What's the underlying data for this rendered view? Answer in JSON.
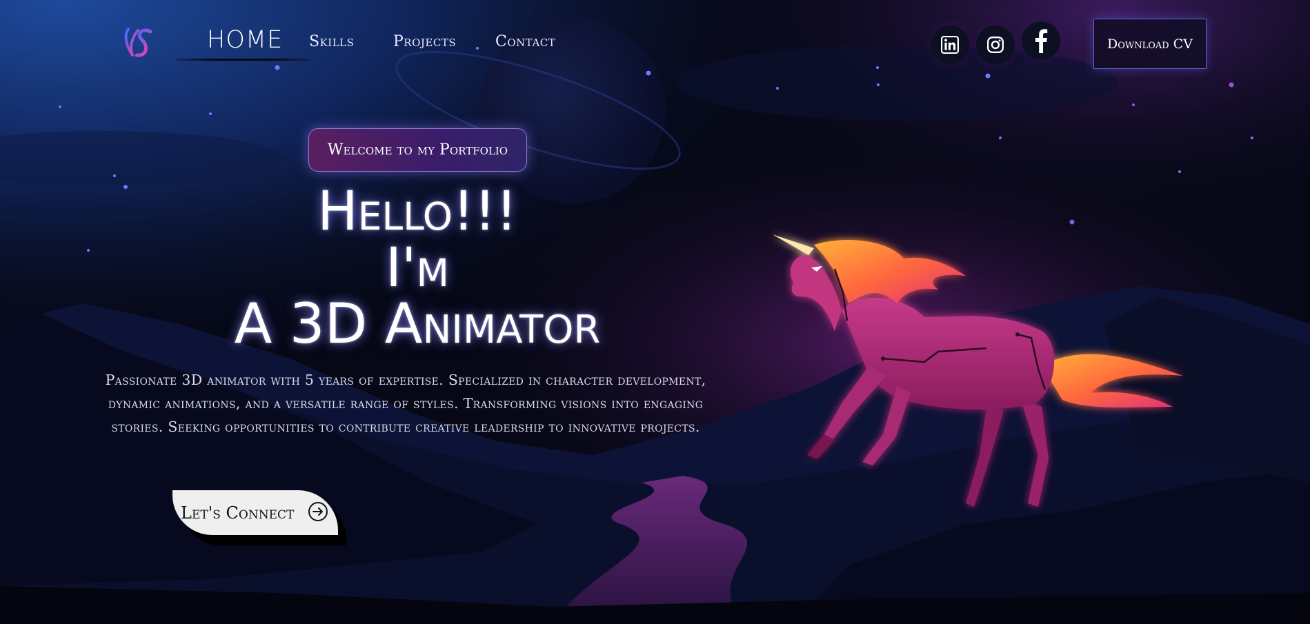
{
  "nav": {
    "home": "HOME",
    "skills": "Skills",
    "projects": "Projects",
    "contact": "Contact"
  },
  "social": {
    "linkedin_icon": "linkedin-icon",
    "instagram_icon": "instagram-icon",
    "facebook_icon": "facebook-icon"
  },
  "download_cv": "Download CV",
  "hero": {
    "badge": "Welcome to my Portfolio",
    "line1": "Hello!!!",
    "line2": "I'm",
    "line3": "A 3D Animator",
    "description": "Passionate 3D animator with 5 years of expertise. Specialized in character development, dynamic animations, and a versatile range of styles. Transforming visions into engaging stories. Seeking opportunities to contribute creative leadership to innovative projects.",
    "cta": "Let's Connect"
  },
  "colors": {
    "accent": "#5a63c7",
    "badge": "#3a1d6a",
    "unicorn": "#b32a78",
    "mane": "#ff6a3d"
  }
}
